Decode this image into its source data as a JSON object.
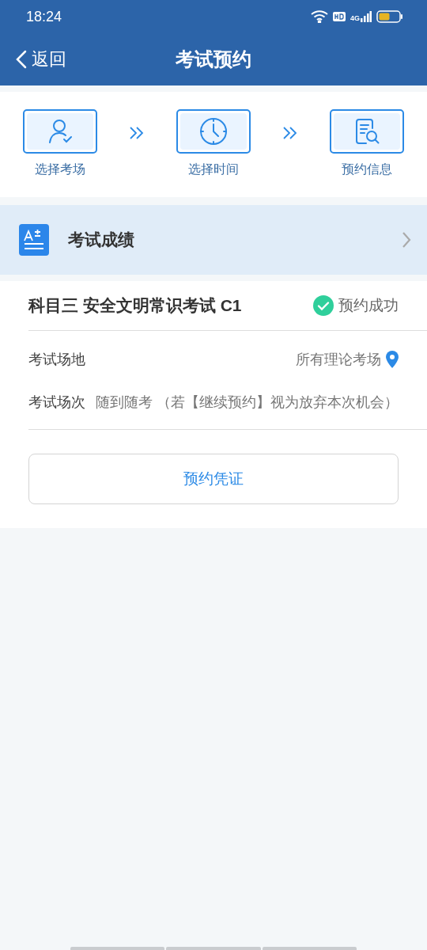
{
  "status_bar": {
    "time": "18:24",
    "network": "4G"
  },
  "header": {
    "back": "返回",
    "title": "考试预约"
  },
  "steps": [
    {
      "kind": "person",
      "label": "选择考场"
    },
    {
      "kind": "clock",
      "label": "选择时间"
    },
    {
      "kind": "document",
      "label": "预约信息"
    }
  ],
  "score_entry": {
    "label": "考试成绩"
  },
  "appointment": {
    "title": "科目三 安全文明常识考试 C1",
    "status": "预约成功",
    "rows": [
      {
        "kind": "location",
        "label": "考试场地",
        "value": "所有理论考场"
      },
      {
        "kind": "text",
        "label": "考试场次",
        "value": "随到随考 （若【继续预约】视为放弃本次机会）"
      }
    ],
    "button": "预约凭证"
  }
}
